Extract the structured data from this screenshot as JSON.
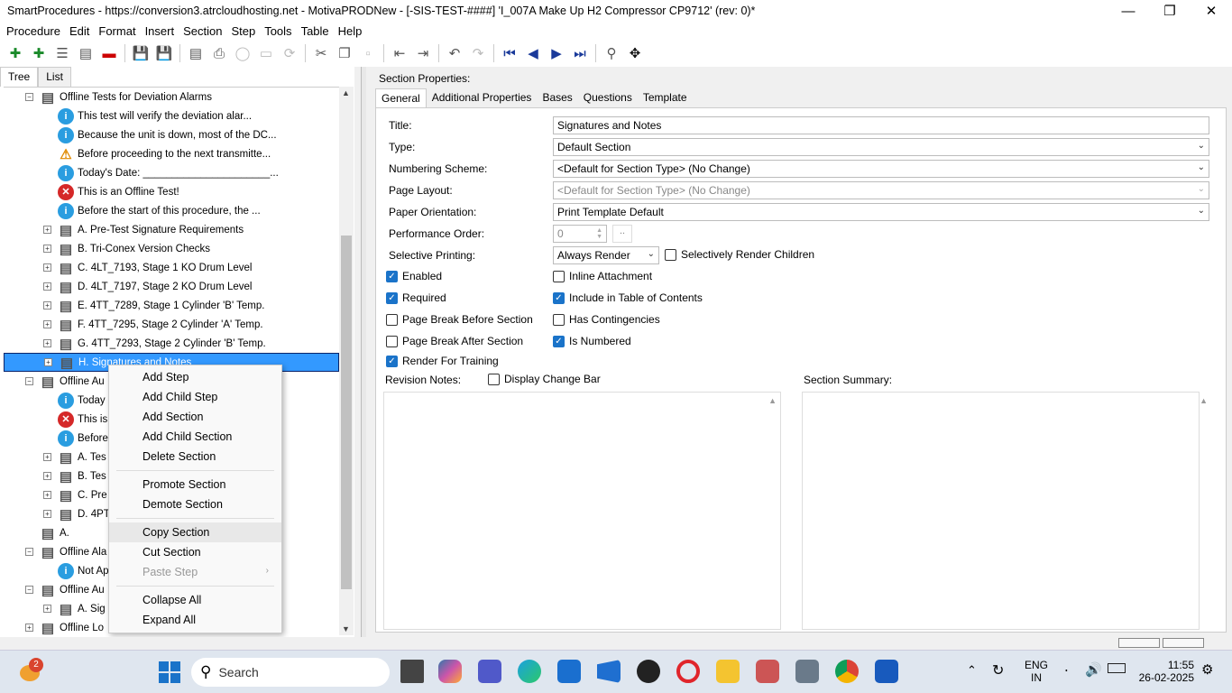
{
  "window": {
    "title": "SmartProcedures - https://conversion3.atrcloudhosting.net - MotivaPRODNew - [-SIS-TEST-####] 'I_007A Make Up H2 Compressor CP9712' (rev: 0)*"
  },
  "menubar": [
    "Procedure",
    "Edit",
    "Format",
    "Insert",
    "Section",
    "Step",
    "Tools",
    "Table",
    "Help"
  ],
  "left_tabs": [
    "Tree",
    "List"
  ],
  "tree": [
    {
      "label": "Offline Tests for Deviation Alarms",
      "icon": "section-icon",
      "level": 1,
      "exp": "−"
    },
    {
      "label": "This test will verify the deviation alar...",
      "icon": "info-icon",
      "level": 2
    },
    {
      "label": "Because the unit is down, most of the DC...",
      "icon": "info-icon",
      "level": 2
    },
    {
      "label": "Before proceeding to the next transmitte...",
      "icon": "warning-icon",
      "level": 2
    },
    {
      "label": "Today's Date: ______________________...",
      "icon": "info-icon",
      "level": 2
    },
    {
      "label": "This is an Offline Test!",
      "icon": "error-icon",
      "level": 2
    },
    {
      "label": "Before the start of this procedure, the ...",
      "icon": "info-icon",
      "level": 2
    },
    {
      "label": "A. Pre-Test Signature Requirements",
      "icon": "section-icon",
      "level": 2,
      "exp": "+"
    },
    {
      "label": "B. Tri-Conex Version Checks",
      "icon": "section-icon",
      "level": 2,
      "exp": "+"
    },
    {
      "label": "C. 4LT_7193, Stage 1 KO Drum Level",
      "icon": "section-icon",
      "level": 2,
      "exp": "+"
    },
    {
      "label": "D. 4LT_7197, Stage 2 KO Drum Level",
      "icon": "section-icon",
      "level": 2,
      "exp": "+"
    },
    {
      "label": "E. 4TT_7289, Stage 1 Cylinder 'B' Temp.",
      "icon": "section-icon",
      "level": 2,
      "exp": "+"
    },
    {
      "label": "F. 4TT_7295, Stage 2 Cylinder 'A' Temp.",
      "icon": "section-icon",
      "level": 2,
      "exp": "+"
    },
    {
      "label": "G. 4TT_7293, Stage 2 Cylinder 'B' Temp.",
      "icon": "section-icon",
      "level": 2,
      "exp": "+"
    },
    {
      "label": "H. Signatures and Notes",
      "icon": "section-icon",
      "level": 2,
      "exp": "+",
      "selected": true
    },
    {
      "label": "Offline Au",
      "icon": "section-icon",
      "level": 1,
      "exp": "−"
    },
    {
      "label": "Today",
      "icon": "info-icon",
      "level": 2
    },
    {
      "label": "This is",
      "icon": "error-icon",
      "level": 2
    },
    {
      "label": "Before",
      "icon": "info-icon",
      "level": 2
    },
    {
      "label": "A. Tes",
      "icon": "section-icon",
      "level": 2,
      "exp": "+"
    },
    {
      "label": "B. Tes",
      "icon": "section-icon",
      "level": 2,
      "exp": "+"
    },
    {
      "label": "C. Pre",
      "icon": "section-icon",
      "level": 2,
      "exp": "+"
    },
    {
      "label": "D. 4PT",
      "icon": "section-icon",
      "level": 2,
      "exp": "+"
    },
    {
      "label": "A.",
      "icon": "section-icon",
      "level": 1
    },
    {
      "label": "Offline Ala",
      "icon": "section-icon",
      "level": 1,
      "exp": "−"
    },
    {
      "label": "Not Ap",
      "icon": "info-icon",
      "level": 2
    },
    {
      "label": "Offline Au",
      "icon": "section-icon",
      "level": 1,
      "exp": "−"
    },
    {
      "label": "A. Sig",
      "icon": "section-icon",
      "level": 2,
      "exp": "+"
    },
    {
      "label": "Offline Lo",
      "icon": "section-icon",
      "level": 1,
      "exp": "+"
    }
  ],
  "section_properties": {
    "header": "Section Properties:",
    "tabs": [
      "General",
      "Additional Properties",
      "Bases",
      "Questions",
      "Template"
    ],
    "title_label": "Title:",
    "title_value": "Signatures and Notes",
    "type_label": "Type:",
    "type_value": "Default Section",
    "numbering_label": "Numbering Scheme:",
    "numbering_value": "<Default for Section Type> (No Change)",
    "layout_label": "Page Layout:",
    "layout_value": "<Default for Section Type> (No Change)",
    "orientation_label": "Paper Orientation:",
    "orientation_value": "Print Template Default",
    "perf_label": "Performance Order:",
    "perf_value": "0",
    "perf_btn": "..",
    "selprint_label": "Selective Printing:",
    "selprint_value": "Always Render",
    "selrender_label": "Selectively Render Children",
    "enabled": "Enabled",
    "required": "Required",
    "pb_before": "Page Break Before Section",
    "pb_after": "Page Break After Section",
    "render_training": "Render For Training",
    "inline_attach": "Inline Attachment",
    "include_toc": "Include in Table of Contents",
    "has_contingencies": "Has Contingencies",
    "is_numbered": "Is Numbered",
    "revision_notes": "Revision Notes:",
    "display_change_bar": "Display Change Bar",
    "section_summary": "Section Summary:"
  },
  "context_menu": [
    {
      "label": "Add Step"
    },
    {
      "label": "Add Child Step"
    },
    {
      "label": "Add Section"
    },
    {
      "label": "Add Child Section"
    },
    {
      "label": "Delete Section"
    },
    {
      "sep": true
    },
    {
      "label": "Promote Section"
    },
    {
      "label": "Demote Section"
    },
    {
      "sep": true
    },
    {
      "label": "Copy Section",
      "highlighted": true
    },
    {
      "label": "Cut Section"
    },
    {
      "label": "Paste Step",
      "disabled": true,
      "submenu": true
    },
    {
      "sep": true
    },
    {
      "label": "Collapse All"
    },
    {
      "label": "Expand All"
    }
  ],
  "taskbar": {
    "notification_count": "2",
    "search": "Search",
    "lang1": "ENG",
    "lang2": "IN",
    "time": "11:55",
    "date": "26-02-2025"
  }
}
